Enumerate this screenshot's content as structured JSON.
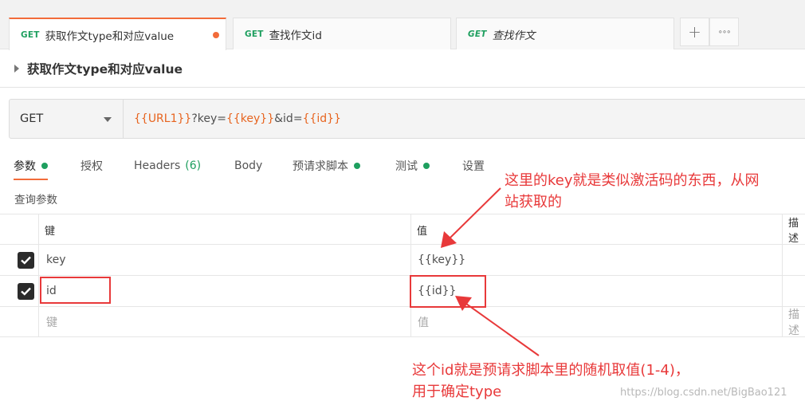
{
  "tabs": [
    {
      "method": "GET",
      "name": "获取作文type和对应value",
      "active": true,
      "unsaved": true,
      "italic": false
    },
    {
      "method": "GET",
      "name": "查找作文id",
      "active": false,
      "unsaved": false,
      "italic": false
    },
    {
      "method": "GET",
      "name": "查找作文",
      "active": false,
      "unsaved": false,
      "italic": true
    }
  ],
  "tab_actions": {
    "add_icon": "plus-icon",
    "more_icon": "more-icon",
    "add": "+",
    "more": "∘∘∘"
  },
  "request": {
    "title": "获取作文type和对应value",
    "method": "GET"
  },
  "url": {
    "parts": [
      {
        "text": "{{URL1}}",
        "is_var": true
      },
      {
        "text": "?key=",
        "is_var": false
      },
      {
        "text": "{{key}}",
        "is_var": true
      },
      {
        "text": "&id=",
        "is_var": false
      },
      {
        "text": "{{id}}",
        "is_var": true
      }
    ]
  },
  "subtabs": [
    {
      "label": "参数",
      "indicator": "dot",
      "active": true
    },
    {
      "label": "授权"
    },
    {
      "label": "Headers",
      "count": "(6)"
    },
    {
      "label": "Body"
    },
    {
      "label": "预请求脚本",
      "indicator": "dot"
    },
    {
      "label": "测试",
      "indicator": "dot"
    },
    {
      "label": "设置"
    }
  ],
  "params": {
    "section_label": "查询参数",
    "headers": {
      "key": "键",
      "value": "值",
      "description": "描述"
    },
    "rows": [
      {
        "checked": true,
        "key": "key",
        "value": "{{key}}"
      },
      {
        "checked": true,
        "key": "id",
        "value": "{{id}}"
      }
    ],
    "placeholder": {
      "key": "键",
      "value": "值",
      "description": "描述"
    }
  },
  "annotations": {
    "note1_line1": "这里的key就是类似激活码的东西，从网",
    "note1_line2": "站获取的",
    "note2_line1": "这个id就是预请求脚本里的随机取值(1-4)，",
    "note2_line2": "用于确定type"
  },
  "watermark": "https://blog.csdn.net/BigBao121",
  "colors": {
    "accent": "#f26b3a",
    "get_method": "#1e9f5f",
    "variable": "#e7641f",
    "annotation": "#e8393a"
  }
}
